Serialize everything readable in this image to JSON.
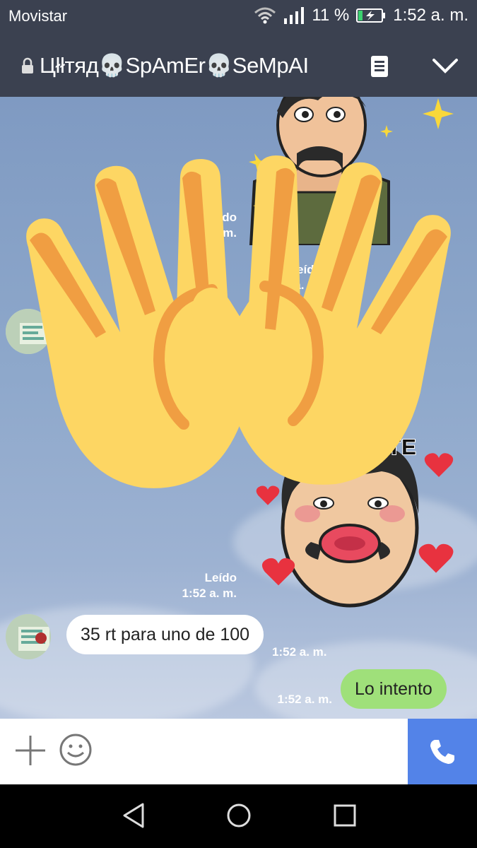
{
  "status_bar": {
    "carrier": "Movistar",
    "battery": "11 %",
    "time": "1:52 a. m."
  },
  "header": {
    "title": "Цłłтяд💀SpAmEr💀SeMpAI"
  },
  "stickers": {
    "kiss_caption": "UN BESOTE"
  },
  "messages": [
    {
      "side": "out",
      "type": "sticker",
      "status": "Leído",
      "time": "1:51 a. m."
    },
    {
      "side": "out",
      "type": "hidden",
      "status": "Leído",
      "time": "1:5_ a. m."
    },
    {
      "side": "out",
      "type": "sticker",
      "status": "Leído",
      "time": "1:52 a. m."
    },
    {
      "side": "in",
      "type": "text",
      "text": "35 rt para uno de 100",
      "time": "1:52 a. m."
    },
    {
      "side": "out",
      "type": "text",
      "text": "Lo intento",
      "time": "1:52 a. m."
    }
  ],
  "colors": {
    "bar": "#3b4150",
    "outgoing_bubble": "#9fe07a",
    "call_button": "#5383e8"
  },
  "icons": [
    "lock-icon",
    "menu-icon",
    "chevron-down-icon",
    "plus-icon",
    "emoji-icon",
    "phone-icon",
    "back-icon",
    "home-icon",
    "recents-icon"
  ]
}
